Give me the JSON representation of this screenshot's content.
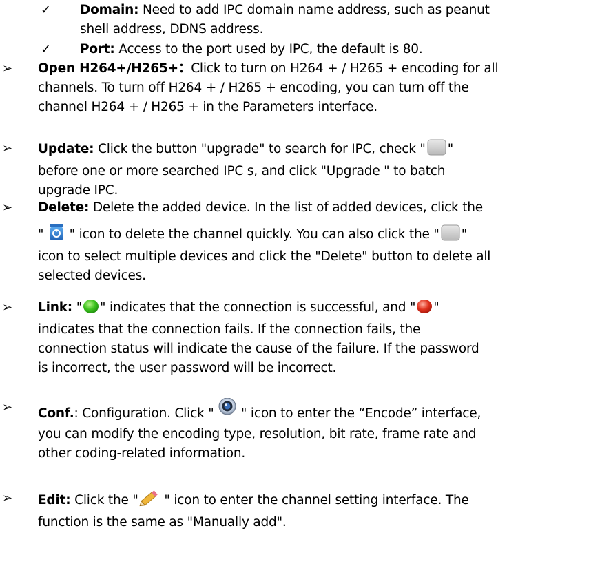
{
  "bullets": {
    "check": "✓",
    "arrow": "➢"
  },
  "sub_items": [
    {
      "label": "Domain:",
      "lines": [
        " Need to add IPC domain name address, such as peanut",
        "shell address, DDNS address."
      ]
    },
    {
      "label": "Port:",
      "lines": [
        " Access to the port used by IPC, the default is 80."
      ]
    }
  ],
  "items": {
    "h264": {
      "label": "Open H264+/H265+：",
      "l1": "Click to turn on H264 + / H265 + encoding for all",
      "l2": "channels. To turn off H264 + / H265 + encoding, you can turn off the",
      "l3": "channel H264 + / H265 + in the Parameters interface."
    },
    "update": {
      "label": "Update:",
      "l1a": " Click the button \"upgrade\" to search for IPC, check \"",
      "l1b": "\"",
      "l2": "before one or more searched IPC s, and click \"Upgrade \" to batch",
      "l3": "upgrade IPC."
    },
    "delete": {
      "label": "Delete:",
      "l1": " Delete the added device. In the list of added devices, click the",
      "l2a": "\" ",
      "l2b": " \" icon to delete the channel quickly. You can also click the \"",
      "l2c": "\"",
      "l3": "icon to select multiple devices and click the \"Delete\" button to delete all",
      "l4": "selected devices."
    },
    "link": {
      "label": "Link:",
      "l1a": " \"",
      "l1b": "\" indicates that the connection is successful, and \"",
      "l1c": "\"",
      "l2": "indicates that the connection fails. If the connection fails, the",
      "l3": "connection status will indicate the cause of the failure. If the password",
      "l4": "is incorrect, the user password will be incorrect."
    },
    "conf": {
      "label": "Conf.",
      "l1a": ": Configuration. Click \" ",
      "l1b": " \" icon to enter the “Encode” interface,",
      "l2": "you can modify the encoding type, resolution, bit rate, frame rate and",
      "l3": "other coding-related information."
    },
    "edit": {
      "label": "Edit:",
      "l1a": " Click the \"",
      "l1b": " \" icon to enter the channel setting interface. The",
      "l2": "function is the same as \"Manually add\"."
    }
  },
  "icons": {
    "checkbox": "checkbox-icon",
    "recycle": "recycle-bin-icon",
    "green": "status-online-icon",
    "red": "status-offline-icon",
    "camera": "camera-lens-icon",
    "pencil": "pencil-edit-icon"
  },
  "colors": {
    "green": "#3cc21e",
    "red": "#e0321e",
    "blue": "#2f7fd2"
  }
}
